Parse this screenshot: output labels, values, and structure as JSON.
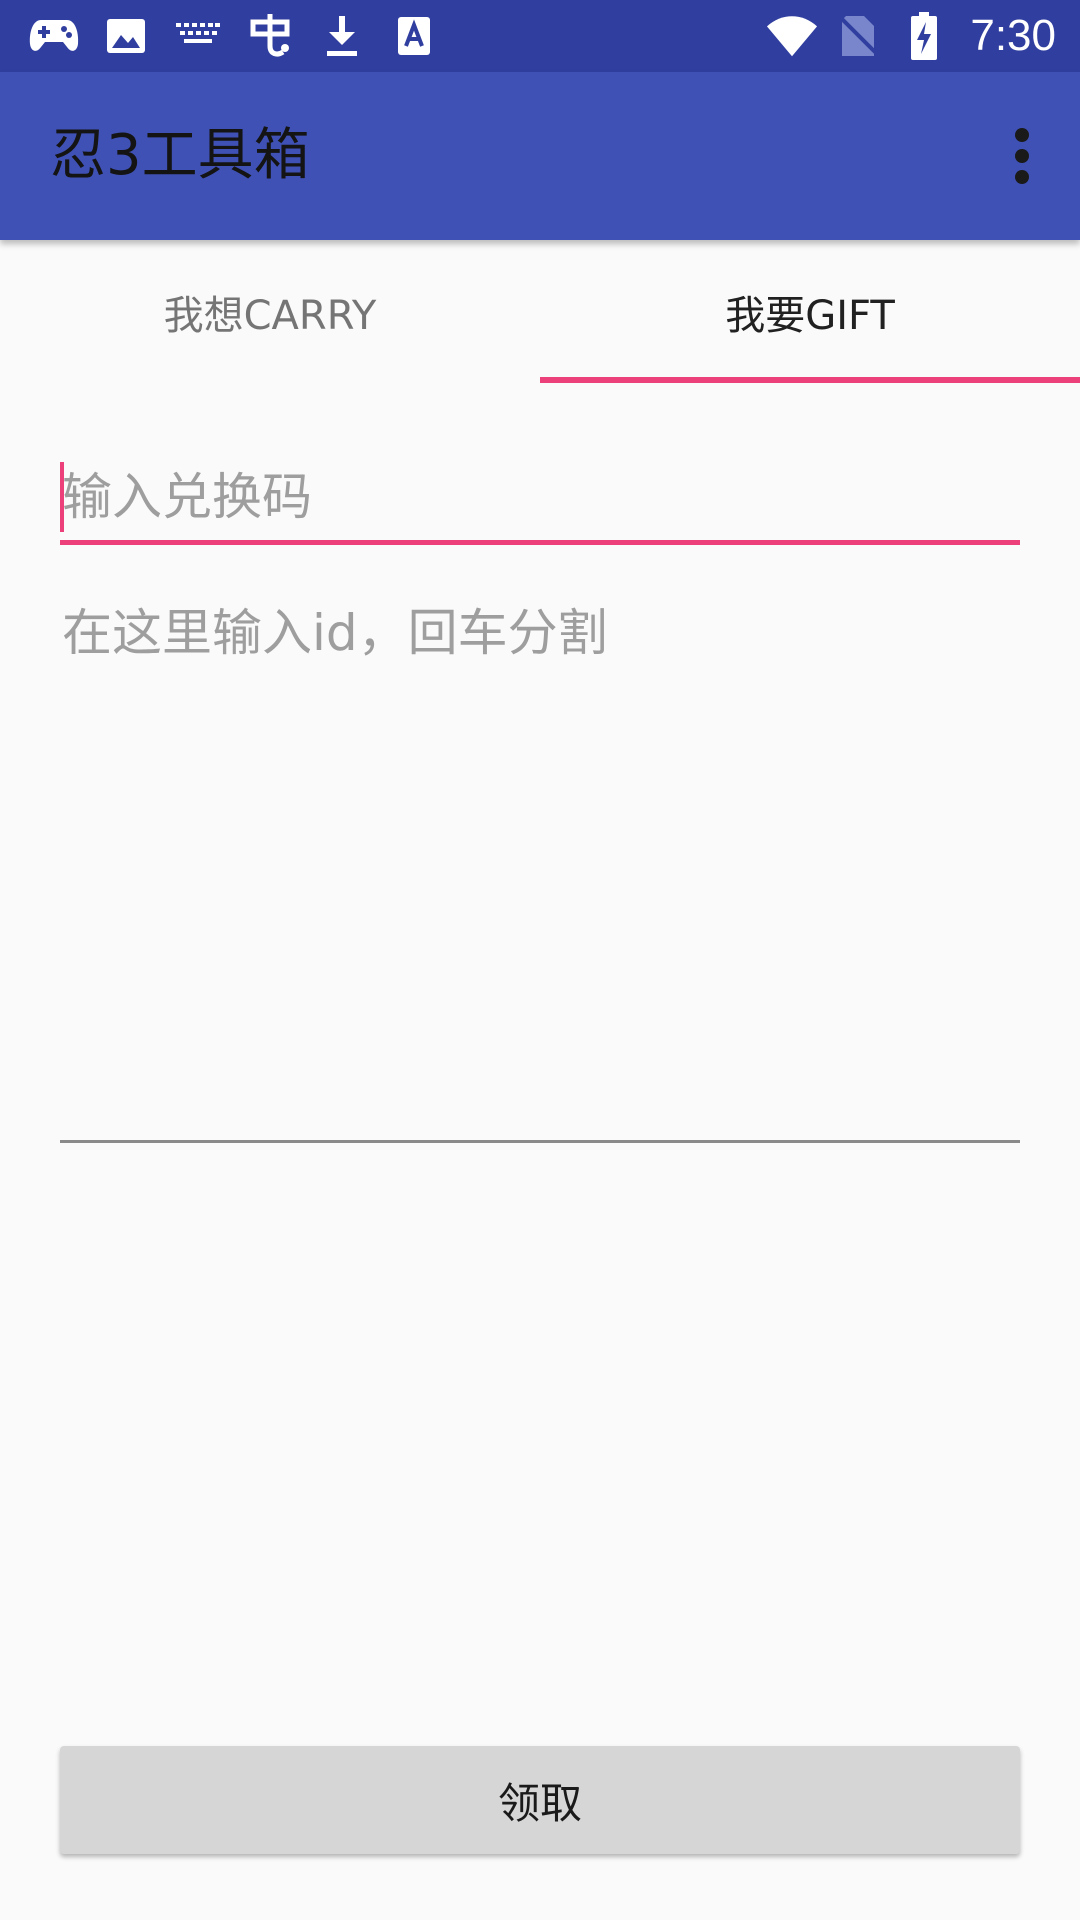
{
  "status_bar": {
    "time": "7:30",
    "left_icons": [
      "gamepad-icon",
      "image-icon",
      "keyboard-icon",
      "hook-icon",
      "download-icon",
      "text-a-icon"
    ],
    "right_icons": [
      "wifi-icon",
      "no-sim-icon",
      "battery-charging-icon"
    ]
  },
  "app_bar": {
    "title": "忍3工具箱",
    "background": "#3f51b5",
    "status_background": "#303f9f"
  },
  "tabs": [
    {
      "label": "我想CARRY",
      "selected": false
    },
    {
      "label": "我要GIFT",
      "selected": true
    }
  ],
  "accent_color": "#ec407a",
  "form": {
    "code_placeholder": "输入兑换码",
    "code_value": "",
    "ids_placeholder": "在这里输入id，回车分割",
    "ids_value": "",
    "submit_label": "领取"
  }
}
